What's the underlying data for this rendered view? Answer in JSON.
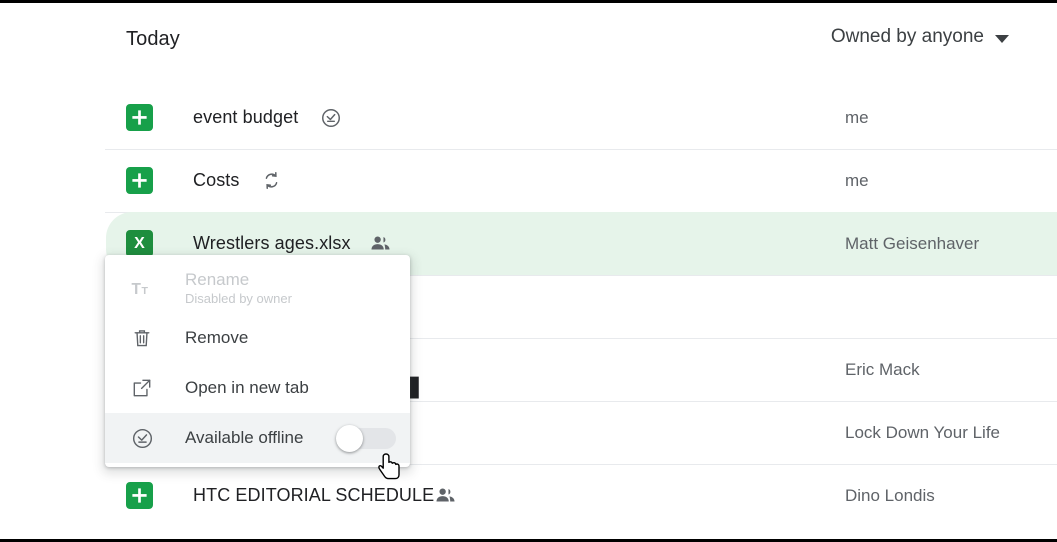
{
  "header": {
    "section_title": "Today",
    "owner_filter_label": "Owned by anyone",
    "owner_filter_icon": "chevron-down-icon"
  },
  "colors": {
    "sheets_green": "#17a04a",
    "excel_green": "#1e8e3e",
    "selected_row_background": "#e6f4ea",
    "menu_hover_background": "#f1f3f4",
    "divider": "#e8eaed",
    "primary_text": "#202124",
    "secondary_text": "#5f6368",
    "disabled_text": "#c6c9cc"
  },
  "files": [
    {
      "name": "event budget",
      "icon": "google-sheets-icon",
      "icon_type": "sheets",
      "badge": "available-offline-icon",
      "owner": "me",
      "selected": false
    },
    {
      "name": "Costs",
      "icon": "google-sheets-icon",
      "icon_type": "sheets",
      "badge": "sync-icon",
      "owner": "me",
      "selected": false
    },
    {
      "name": "Wrestlers ages.xlsx",
      "icon": "excel-file-icon",
      "icon_type": "excel",
      "badge": "shared-people-icon",
      "owner": "Matt Geisenhaver",
      "selected": true
    },
    {
      "name": "",
      "icon": "",
      "icon_type": "hidden",
      "badge": "",
      "owner": "",
      "selected": false
    },
    {
      "name": "",
      "icon": "",
      "icon_type": "hidden",
      "badge": "",
      "owner": "Eric Mack",
      "selected": false
    },
    {
      "name": "",
      "icon": "",
      "icon_type": "hidden",
      "badge": "",
      "owner": "Lock Down Your Life",
      "selected": false
    },
    {
      "name": "HTC EDITORIAL SCHEDULE",
      "icon": "google-sheets-icon",
      "icon_type": "sheets",
      "badge": "shared-people-icon",
      "owner": "Dino Londis",
      "selected": false
    }
  ],
  "context_menu": {
    "items": [
      {
        "label": "Rename",
        "sublabel": "Disabled by owner",
        "icon": "text-format-icon",
        "state": "disabled"
      },
      {
        "label": "Remove",
        "sublabel": "",
        "icon": "trash-icon",
        "state": "enabled"
      },
      {
        "label": "Open in new tab",
        "sublabel": "",
        "icon": "open-in-new-icon",
        "state": "enabled"
      },
      {
        "label": "Available offline",
        "sublabel": "",
        "icon": "available-offline-icon",
        "state": "hover",
        "toggle": "off"
      }
    ]
  },
  "cursor": {
    "type": "pointer-hand-cursor"
  }
}
